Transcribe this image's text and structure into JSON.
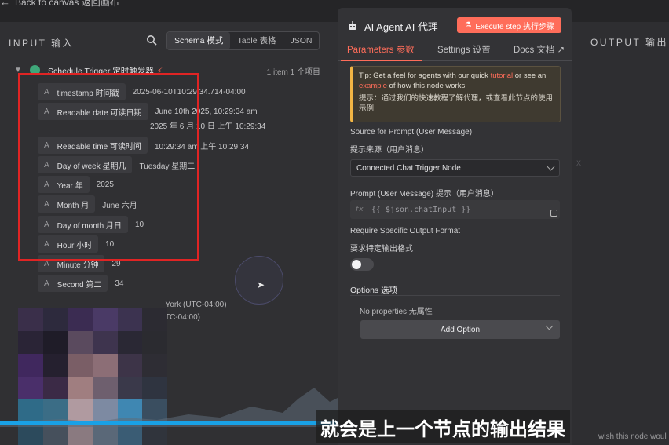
{
  "top": {
    "back_label": "Back to canvas 返回画布"
  },
  "input_panel": {
    "title": "INPUT 输入",
    "view_modes": [
      "Schema 模式",
      "Table 表格",
      "JSON"
    ],
    "active_view": "Schema 模式",
    "node": {
      "name": "Schedule Trigger 定时触发器",
      "count": "1 item 1 个项目"
    },
    "fields": [
      {
        "key": "timestamp 时间戳",
        "value": "2025-06-10T10:29:34.714-04:00",
        "value2": ""
      },
      {
        "key": "Readable date 可读日期",
        "value": "June 10th 2025, 10:29:34 am",
        "value2": "2025 年 6 月 10 日 上午 10:29:34"
      },
      {
        "key": "Readable time 可读时间",
        "value": "10:29:34 am 上午 10:29:34",
        "value2": ""
      },
      {
        "key": "Day of week 星期几",
        "value": "Tuesday 星期二",
        "value2": ""
      },
      {
        "key": "Year 年",
        "value": "2025",
        "value2": ""
      },
      {
        "key": "Month 月",
        "value": "June 六月",
        "value2": ""
      },
      {
        "key": "Day of month 月日",
        "value": "10",
        "value2": ""
      },
      {
        "key": "Hour 小时",
        "value": "10",
        "value2": ""
      },
      {
        "key": "Minute 分钟",
        "value": "29",
        "value2": ""
      },
      {
        "key": "Second 第二",
        "value": "34",
        "value2": ""
      }
    ],
    "timezone_lines": [
      "_York (UTC-04:00)",
      "TC-04:00)"
    ]
  },
  "agent_panel": {
    "title": "AI Agent AI 代理",
    "execute_label": "Execute step 执行步骤",
    "tabs": [
      "Parameters 参数",
      "Settings 设置",
      "Docs 文档"
    ],
    "tip": {
      "prefix": "Tip: Get a feel for agents with our quick ",
      "link1": "tutorial",
      "middle": " or see an ",
      "link2": "example",
      "suffix": " of how this node works",
      "zh": "提示：通过我们的快速教程了解代理，或查看此节点的使用示例"
    },
    "source_label": "Source for Prompt (User Message)",
    "source_label_zh": "提示来源（用户消息）",
    "source_value": "Connected Chat Trigger Node",
    "prompt_label": "Prompt (User Message) 提示（用户消息）",
    "prompt_fx": "fx",
    "prompt_value": "{{ $json.chatInput }}",
    "require_label": "Require Specific Output Format",
    "require_label_zh": "要求特定输出格式",
    "require_enabled": false,
    "options_title": "Options 选项",
    "no_properties": "No properties 无属性",
    "add_option_label": "Add Option"
  },
  "output_panel": {
    "title": "OUTPUT 输出"
  },
  "subtitle": "就会是上一个节点的输出结果",
  "ghost_caption": "wish this node woul",
  "colors": {
    "accent": "#ff6d5a",
    "highlight_box": "#e02424",
    "progress": "#19a1e6",
    "tip_border": "#f2b544"
  }
}
